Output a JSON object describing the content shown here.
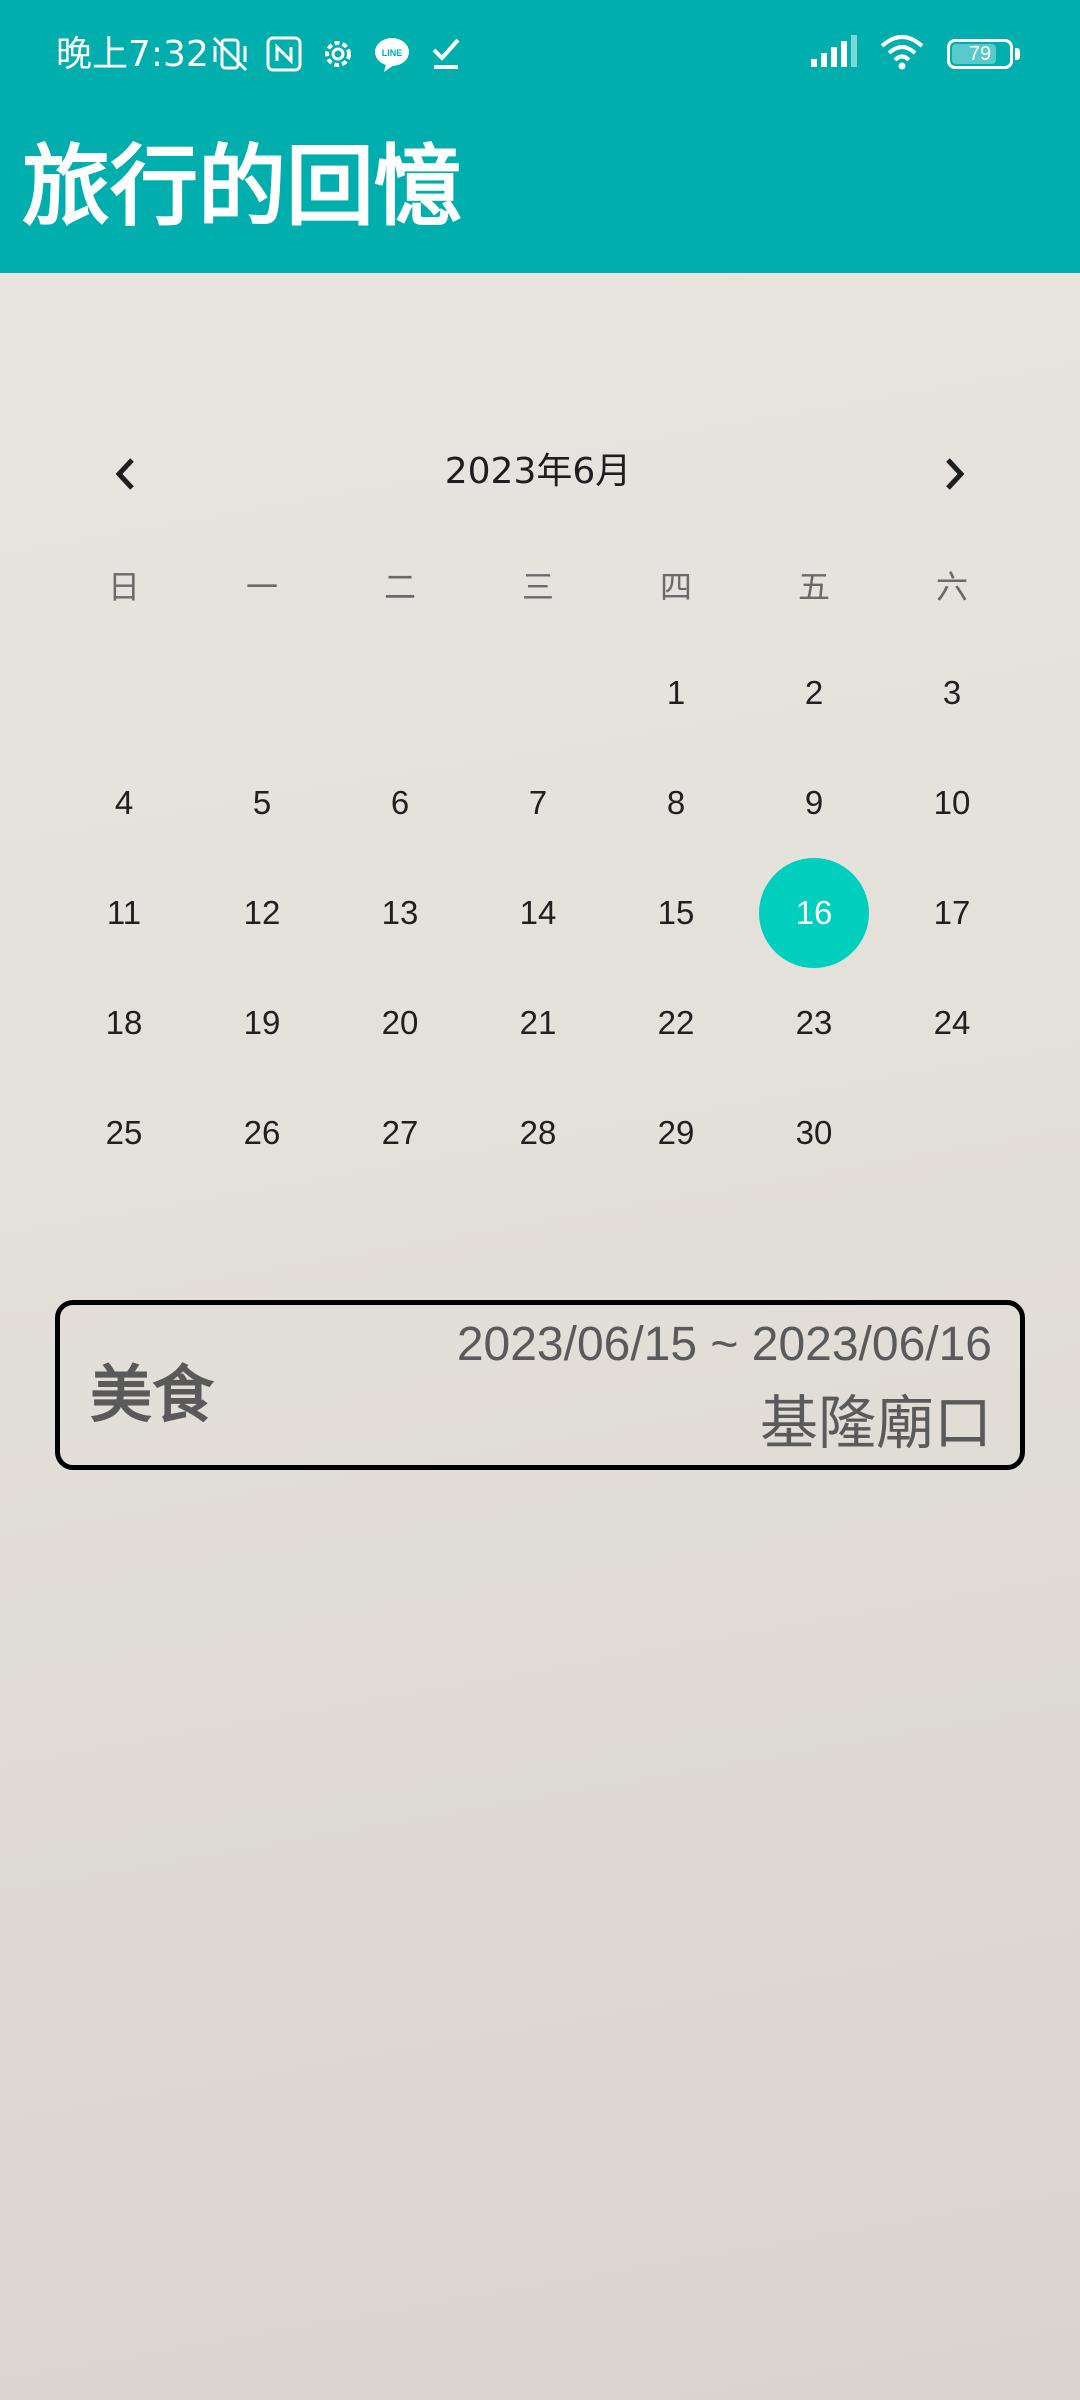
{
  "status_bar": {
    "time": "晚上7:32",
    "battery": "79",
    "battery_level": 0.79,
    "left_icons": [
      "vibrate-off-icon",
      "nfc-icon",
      "settings-icon",
      "line-app-icon",
      "check-icon"
    ],
    "right_icons": [
      "signal-icon",
      "wifi-icon",
      "battery-icon"
    ]
  },
  "header": {
    "title": "旅行的回憶",
    "color": "#00aead"
  },
  "calendar": {
    "month_label": "2023年6月",
    "prev_icon": "chevron-left-icon",
    "next_icon": "chevron-right-icon",
    "weekdays": [
      "日",
      "一",
      "二",
      "三",
      "四",
      "五",
      "六"
    ],
    "days": [
      "",
      "",
      "",
      "",
      "1",
      "2",
      "3",
      "4",
      "5",
      "6",
      "7",
      "8",
      "9",
      "10",
      "11",
      "12",
      "13",
      "14",
      "15",
      "16",
      "17",
      "18",
      "19",
      "20",
      "21",
      "22",
      "23",
      "24",
      "25",
      "26",
      "27",
      "28",
      "29",
      "30",
      ""
    ],
    "selected_day": "16",
    "selected_color": "#00cfbd"
  },
  "memory_card": {
    "category": "美食",
    "date_range": "2023/06/15 ~ 2023/06/16",
    "place": "基隆廟口"
  }
}
